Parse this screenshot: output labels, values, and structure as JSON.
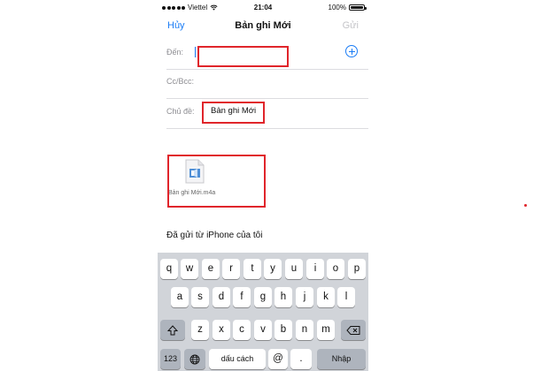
{
  "status_bar": {
    "carrier": "Viettel",
    "time": "21:04",
    "battery": "100%"
  },
  "nav": {
    "cancel_label": "Hủy",
    "title": "Bản ghi Mới",
    "send_label": "Gửi"
  },
  "fields": {
    "to_label": "Đến:",
    "cc_label": "Cc/Bcc:",
    "subject_label": "Chủ đề:",
    "subject_value": "Bản ghi Mới"
  },
  "attachment": {
    "file_name": "Bản ghi Mới.m4a"
  },
  "body": {
    "signature": "Đã gửi từ iPhone của tôi"
  },
  "keyboard": {
    "row1": [
      "q",
      "w",
      "e",
      "r",
      "t",
      "y",
      "u",
      "i",
      "o",
      "p"
    ],
    "row2": [
      "a",
      "s",
      "d",
      "f",
      "g",
      "h",
      "j",
      "k",
      "l"
    ],
    "row3": [
      "z",
      "x",
      "c",
      "v",
      "b",
      "n",
      "m"
    ],
    "numbers_key": "123",
    "space_key": "dấu cách",
    "at_key": "@",
    "dot_key": ".",
    "return_key": "Nhập"
  },
  "colors": {
    "accent": "#1a7cf5",
    "highlight": "#e0252b",
    "keyboard_bg": "#d1d4d9"
  }
}
